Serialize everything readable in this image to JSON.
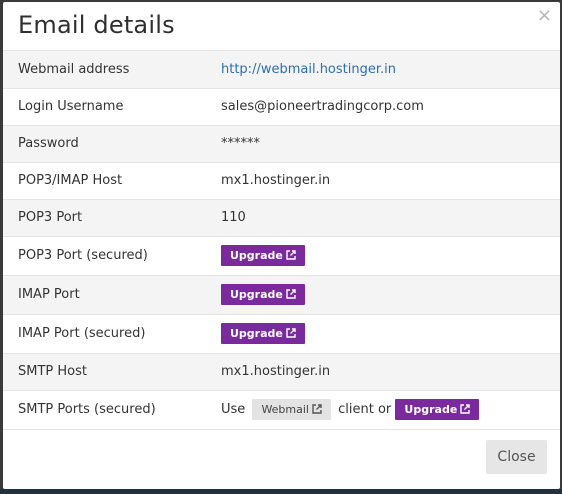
{
  "modal": {
    "title": "Email details",
    "close_symbol": "×",
    "close_button_label": "Close"
  },
  "rows": [
    {
      "label": "Webmail address",
      "value": "http://webmail.hostinger.in"
    },
    {
      "label": "Login Username",
      "value": "sales@pioneertradingcorp.com"
    },
    {
      "label": "Password",
      "value": "******"
    },
    {
      "label": "POP3/IMAP Host",
      "value": "mx1.hostinger.in"
    },
    {
      "label": "POP3 Port",
      "value": "110"
    },
    {
      "label": "POP3 Port (secured)",
      "button": "Upgrade"
    },
    {
      "label": "IMAP Port",
      "button": "Upgrade"
    },
    {
      "label": "IMAP Port (secured)",
      "button": "Upgrade"
    },
    {
      "label": "SMTP Host",
      "value": "mx1.hostinger.in"
    },
    {
      "label": "SMTP Ports (secured)",
      "prefix": "Use",
      "webmail_button": "Webmail",
      "middle": "client or",
      "button": "Upgrade"
    }
  ],
  "colors": {
    "upgrade_button": "#7b2a9e",
    "link": "#2a6fb0"
  },
  "icons": {
    "external_link": "external-link-icon",
    "close": "close-icon"
  }
}
